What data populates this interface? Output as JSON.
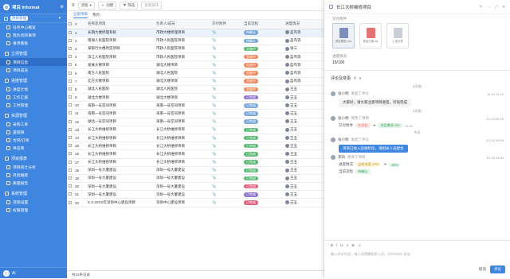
{
  "sidebar": {
    "brand": "项目 Informat",
    "sub_title": "项目管理",
    "items": [
      {
        "label": "任务中心概览",
        "group": false
      },
      {
        "label": "我负责的事项",
        "group": false
      },
      {
        "label": "事项看板",
        "group": false
      },
      {
        "label": "立项管理",
        "group": true
      },
      {
        "label": "项目信息",
        "group": false,
        "active": true
      },
      {
        "label": "项目成员",
        "group": false
      },
      {
        "label": "进度管理",
        "group": true
      },
      {
        "label": "进度计划",
        "group": false
      },
      {
        "label": "工作汇报",
        "group": false
      },
      {
        "label": "工时管理",
        "group": false
      },
      {
        "label": "资源管理",
        "group": true
      },
      {
        "label": "采购工单",
        "group": false
      },
      {
        "label": "里程碑",
        "group": false
      },
      {
        "label": "合同/订单",
        "group": false
      },
      {
        "label": "供应商",
        "group": false
      },
      {
        "label": "项目报表",
        "group": true
      },
      {
        "label": "项目统计分析",
        "group": false
      },
      {
        "label": "风险跟踪",
        "group": false
      },
      {
        "label": "质量报告",
        "group": false
      },
      {
        "label": "系统管理",
        "group": true
      },
      {
        "label": "流程设置",
        "group": false
      },
      {
        "label": "权限管理",
        "group": false
      }
    ],
    "footer_user": "Ai"
  },
  "toolbar": {
    "title": "流程",
    "add": "创建",
    "filter": "筛选",
    "batch": "批量操作"
  },
  "tabs": {
    "all": "全部项目",
    "mine": "我的"
  },
  "table": {
    "headers": [
      "#",
      "名称及项目",
      "负责人/成员",
      "交付附件",
      "当前流程",
      "进度情况"
    ],
    "rows": [
      {
        "n": "1",
        "name": "长期大楼修理系统",
        "owner": "市政大楼修理项目",
        "att": "📎",
        "stage": "待确认",
        "color": "#7aa7d8",
        "user": "蓝鸟等"
      },
      {
        "n": "2",
        "name": "南湖人民医院项目",
        "owner": "市政人民医院项目",
        "att": "📎",
        "stage": "待确认",
        "color": "#7aa7d8",
        "user": "蓝鸟等"
      },
      {
        "n": "3",
        "name": "某银行大楼改造项目",
        "owner": "市政人民医院项目",
        "att": "📎",
        "stage": "实施中",
        "color": "#58b872",
        "user": "张三"
      },
      {
        "n": "4",
        "name": "滨江人民医院项目",
        "owner": "市政人民医院项目",
        "att": "📎",
        "stage": "验收中",
        "color": "#f08a5d",
        "user": "蓝鸟等"
      },
      {
        "n": "5",
        "name": "发展大楼项目",
        "owner": "湖北大楼项目",
        "att": "📎",
        "stage": "验收中",
        "color": "#f08a5d",
        "user": "蓝鸟等"
      },
      {
        "n": "6",
        "name": "南方人民医院",
        "owner": "湖北人民医院",
        "att": "📎",
        "stage": "验收中",
        "color": "#f08a5d",
        "user": "蓝鸟等"
      },
      {
        "n": "7",
        "name": "北方大楼项目",
        "owner": "湖北大楼项目",
        "att": "📎",
        "stage": "验收中",
        "color": "#f08a5d",
        "user": "蓝鸟等"
      },
      {
        "n": "8",
        "name": "湖北人民医院",
        "owner": "湖北人民医院",
        "att": "📎",
        "stage": "验收中",
        "color": "#f08a5d",
        "user": "王五"
      },
      {
        "n": "9",
        "name": "湖北大楼项目",
        "owner": "湖北大楼项目",
        "att": "📎",
        "stage": "已完成",
        "color": "#8f73c9",
        "user": "王五"
      },
      {
        "n": "10",
        "name": "海南一号空间项目",
        "owner": "海南一号空间项目",
        "att": "📎",
        "stage": "已完成",
        "color": "#7aa7d8",
        "user": "王五"
      },
      {
        "n": "11",
        "name": "海南一号空间项目",
        "owner": "海南一号空间项目",
        "att": "📎",
        "stage": "已完成",
        "color": "#7aa7d8",
        "user": "王五"
      },
      {
        "n": "12",
        "name": "湖北一号空间项目",
        "owner": "海南一号空间项目",
        "att": "📎",
        "stage": "已完成",
        "color": "#7aa7d8",
        "user": "王五"
      },
      {
        "n": "13",
        "name": "长江大桥维修项目",
        "owner": "长江大桥维修项目",
        "att": "📎",
        "stage": "已完成",
        "color": "#58b872",
        "user": "王五"
      },
      {
        "n": "14",
        "name": "长江大桥维修项目",
        "owner": "长江大桥维修项目",
        "att": "📎",
        "stage": "已完成",
        "color": "#58b872",
        "user": "王五"
      },
      {
        "n": "15",
        "name": "长江大桥维修项目",
        "owner": "长江大桥维修项目",
        "att": "📎",
        "stage": "已完成",
        "color": "#58b872",
        "user": "王五"
      },
      {
        "n": "16",
        "name": "长江大桥维修项目",
        "owner": "长江大桥维修项目",
        "att": "📎",
        "stage": "已完成",
        "color": "#58b872",
        "user": "王五"
      },
      {
        "n": "17",
        "name": "长江大桥维修项目",
        "owner": "长江大桥维修项目",
        "att": "📎",
        "stage": "已完成",
        "color": "#58b872",
        "user": "王五"
      },
      {
        "n": "18",
        "name": "深圳一号大厦建设",
        "owner": "深圳一号大厦建设",
        "att": "📎",
        "stage": "已完成",
        "color": "#58b872",
        "user": "王五"
      },
      {
        "n": "19",
        "name": "深圳一号大厦建设",
        "owner": "深圳一号大厦建设",
        "att": "📎",
        "stage": "已完成",
        "color": "#58b872",
        "user": "王五"
      },
      {
        "n": "20",
        "name": "深圳一号大厦建设",
        "owner": "深圳一号大厦建设",
        "att": "📎",
        "stage": "已完成",
        "color": "#e25e7a",
        "user": "王五"
      },
      {
        "n": "21",
        "name": "深圳一号大厦建设",
        "owner": "深圳一号大厦建设",
        "att": "📎",
        "stage": "已完成",
        "color": "#8f73c9",
        "user": "王五"
      },
      {
        "n": "22",
        "name": "X.X.20XX年深圳中心建设项目",
        "owner": "深圳中心建设项目",
        "att": "📎",
        "stage": "已完成",
        "color": "#e25e7a",
        "user": "王五"
      }
    ],
    "footer": "共22条记录"
  },
  "panel": {
    "title": "长江大桥维修项目",
    "attach_label": "交付附件",
    "files": [
      {
        "name": "项目需求.doc",
        "color": "#7d8fb8",
        "hl": true
      },
      {
        "name": "项目方案.xls",
        "color": "#e57373",
        "hl": false
      },
      {
        "name": "上传文件",
        "color": "#c9ced8",
        "hl": false
      }
    ],
    "progress_label": "进度情况",
    "progress_value": "15/100",
    "log_title": "评论及变更",
    "log_count": "4",
    "log": [
      {
        "type": "center",
        "text": "2天前"
      },
      {
        "type": "line",
        "user": "张小明",
        "action": "发起了评论",
        "time": "12-12 11:20"
      },
      {
        "type": "bubble",
        "text": "大家好，请大家注意项目进度，尽快完成"
      },
      {
        "type": "center",
        "text": "1天前"
      },
      {
        "type": "line",
        "user": "张小明",
        "action": "修改了项目",
        "time": "12-13 09:15"
      },
      {
        "type": "change",
        "field": "交付附件",
        "from": "空项目",
        "to": "项目需求.doc",
        "time": "11-20"
      },
      {
        "type": "center",
        "text": "今天"
      },
      {
        "type": "line",
        "user": "张小明",
        "action": "发起了评论",
        "time": "12-15 10:05"
      },
      {
        "type": "blue",
        "text": "项目已进入验收阶段，请相关人员配合"
      },
      {
        "type": "line",
        "user": "李四",
        "action": "修改了项目",
        "time": "12-15 14:30"
      },
      {
        "type": "change2",
        "field": "进度情况",
        "from": "当前进度 10%",
        "to": "15%"
      },
      {
        "type": "change3",
        "field": "当前流程",
        "to": "待确认"
      }
    ],
    "composer_tools": [
      "B",
      "I",
      "U",
      "≡",
      "⊕",
      "☺"
    ],
    "composer_placeholder": "输入评论内容，输入@提醒相关人员，Ctrl+Enter 发送",
    "cancel": "取消",
    "send": "评论"
  }
}
